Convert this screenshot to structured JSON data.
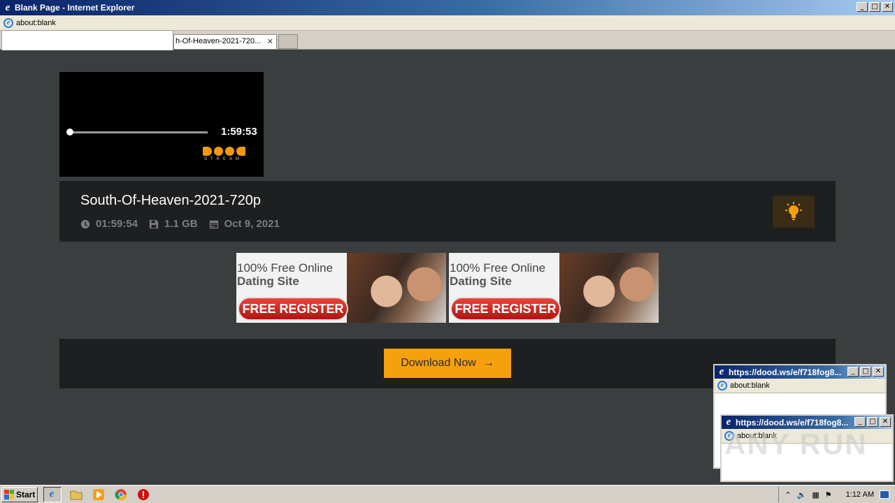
{
  "window": {
    "title": "Blank Page - Internet Explorer",
    "address": "about:blank",
    "tab_label": "h-Of-Heaven-2021-720...",
    "controls": {
      "minimize": "_",
      "maximize": "□",
      "close": "✕"
    }
  },
  "player": {
    "duration": "1:59:53",
    "progress": 0.0,
    "logo_sub": "STREAM"
  },
  "video": {
    "title": "South-Of-Heaven-2021-720p",
    "length": "01:59:54",
    "size": "1.1 GB",
    "date": "Oct 9, 2021"
  },
  "ads": [
    {
      "line1": "100% Free Online",
      "line2": "Dating Site",
      "button": "FREE REGISTER"
    },
    {
      "line1": "100% Free Online",
      "line2": "Dating Site",
      "button": "FREE REGISTER"
    }
  ],
  "download": {
    "label": "Download Now",
    "arrow": "→"
  },
  "popups": [
    {
      "title": "https://dood.ws/e/f718fog8...",
      "address": "about:blank"
    },
    {
      "title": "https://dood.ws/e/f718fog8...",
      "address": "about:blank"
    }
  ],
  "watermark": "ANY RUN",
  "taskbar": {
    "start_label": "Start",
    "clock": "1:12 AM"
  },
  "colors": {
    "accent": "#f6a00e",
    "panel": "#1e1f20",
    "background": "#3b3e3f"
  }
}
